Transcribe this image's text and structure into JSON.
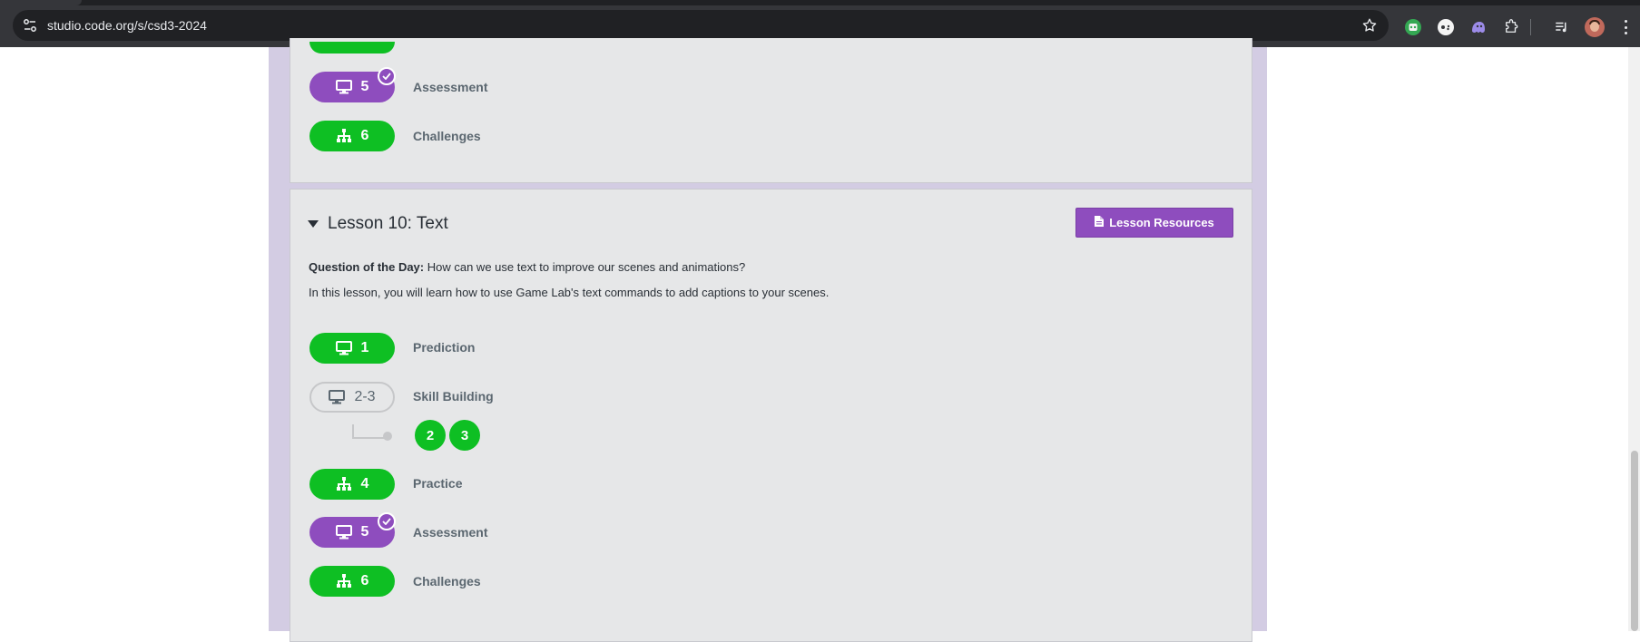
{
  "browser": {
    "url": "studio.code.org/s/csd3-2024",
    "extension_icons": [
      "robot-extension-icon",
      "gamepad-extension-icon",
      "ghost-extension-icon",
      "puzzle-extensions-icon",
      "media-control-icon"
    ]
  },
  "previous_lesson": {
    "levels": [
      {
        "number": "5",
        "label": "Assessment",
        "style": "purple",
        "icon": "monitor-icon",
        "checked": true
      },
      {
        "number": "6",
        "label": "Challenges",
        "style": "green",
        "icon": "hierarchy-icon",
        "checked": false
      }
    ]
  },
  "lesson": {
    "title": "Lesson 10: Text",
    "resources_label": "Lesson Resources",
    "question_label": "Question of the Day:",
    "question_text": " How can we use text to improve our scenes and animations?",
    "description": "In this lesson, you will learn how to use Game Lab's text commands to add captions to your scenes.",
    "levels": [
      {
        "number": "1",
        "label": "Prediction",
        "style": "green",
        "icon": "monitor-icon"
      },
      {
        "number": "2-3",
        "label": "Skill Building",
        "style": "outline",
        "icon": "monitor-icon",
        "sublevels": [
          "2",
          "3"
        ]
      },
      {
        "number": "4",
        "label": "Practice",
        "style": "green",
        "icon": "hierarchy-icon"
      },
      {
        "number": "5",
        "label": "Assessment",
        "style": "purple",
        "icon": "monitor-icon",
        "checked": true
      },
      {
        "number": "6",
        "label": "Challenges",
        "style": "green",
        "icon": "hierarchy-icon"
      }
    ]
  },
  "colors": {
    "green": "#0ebf23",
    "purple": "#8e4dbe",
    "unit_background": "#d3cce3"
  }
}
